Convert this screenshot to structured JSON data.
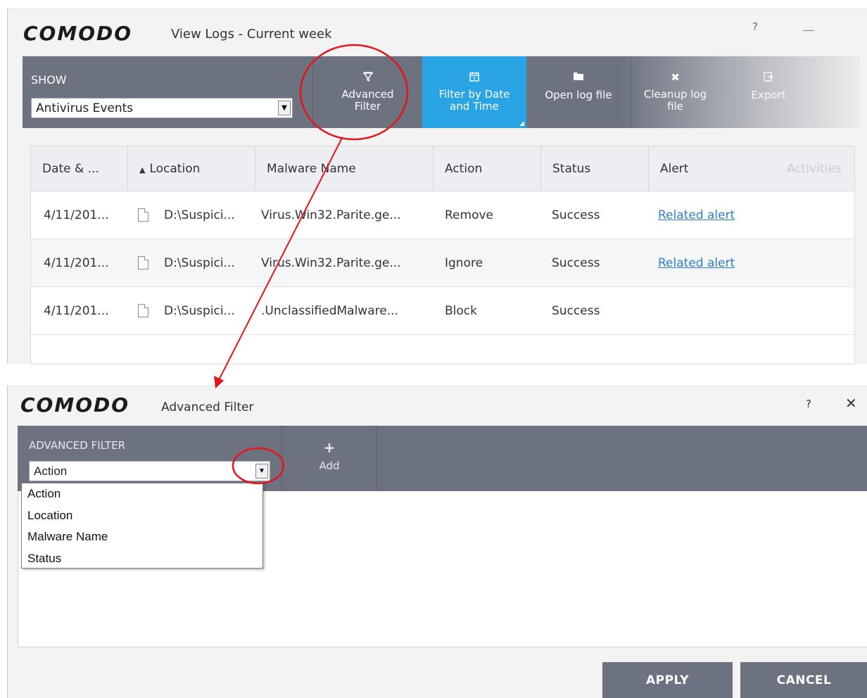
{
  "view_logs_window": {
    "logo": "COMODO",
    "title": "View Logs - Current week",
    "help": "?",
    "toolbar": {
      "show_label": "SHOW",
      "show_selected": "Antivirus Events",
      "tools": [
        {
          "icon": "filter-icon",
          "label_line1": "Advanced",
          "label_line2": "Filter"
        },
        {
          "icon": "calendar-icon",
          "label_line1": "Filter by Date",
          "label_line2": "and Time"
        },
        {
          "icon": "folder-icon",
          "label_line1": "Open log file",
          "label_line2": ""
        },
        {
          "icon": "cleanup-icon",
          "label_line1": "Cleanup log",
          "label_line2": "file"
        },
        {
          "icon": "export-icon",
          "label_line1": "Export",
          "label_line2": ""
        }
      ]
    },
    "table": {
      "columns": [
        "Date & ...",
        "Location",
        "Malware Name",
        "Action",
        "Status",
        "Alert",
        "Activities"
      ],
      "rows": [
        {
          "date": "4/11/201...",
          "location": "D:\\Suspici...",
          "malware": "Virus.Win32.Parite.ge...",
          "action": "Remove",
          "status": "Success",
          "alert": "Related alert"
        },
        {
          "date": "4/11/201...",
          "location": "D:\\Suspici...",
          "malware": "Virus.Win32.Parite.ge...",
          "action": "Ignore",
          "status": "Success",
          "alert": "Related alert"
        },
        {
          "date": "4/11/201...",
          "location": "D:\\Suspici...",
          "malware": ".UnclassifiedMalware...",
          "action": "Block",
          "status": "Success",
          "alert": ""
        }
      ]
    }
  },
  "advanced_filter_window": {
    "logo": "COMODO",
    "title": "Advanced Filter",
    "help": "?",
    "close": "✕",
    "toolbar": {
      "label": "ADVANCED FILTER",
      "selected": "Action",
      "add_label": "Add"
    },
    "dropdown_options": [
      "Action",
      "Location",
      "Malware Name",
      "Status"
    ],
    "buttons": {
      "apply": "APPLY",
      "cancel": "CANCEL"
    }
  },
  "colors": {
    "toolbar": "#6c7280",
    "active_tool": "#29a5e6",
    "annotation": "#e8141c",
    "link": "#2f7fd2"
  }
}
